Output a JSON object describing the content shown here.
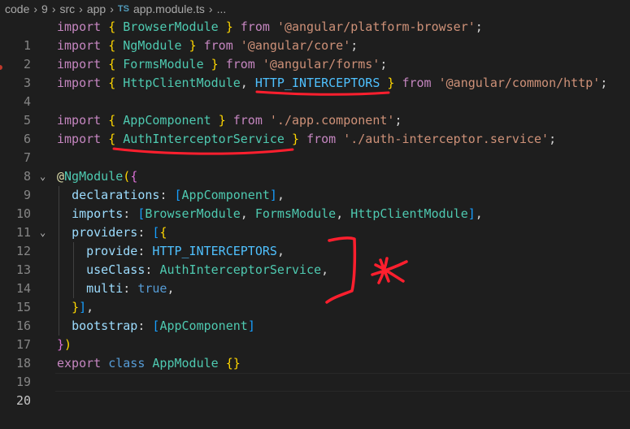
{
  "breadcrumb": {
    "items": [
      "code",
      "9",
      "src",
      "app"
    ],
    "file_badge": "TS",
    "file_name": "app.module.ts",
    "trailing": "..."
  },
  "line_numbers": [
    "1",
    "2",
    "3",
    "4",
    "5",
    "6",
    "7",
    "8",
    "9",
    "10",
    "11",
    "12",
    "13",
    "14",
    "15",
    "16",
    "17",
    "18",
    "19",
    "20"
  ],
  "tokens": {
    "import": "import",
    "from": "from",
    "open_brace": "{",
    "close_brace": "}",
    "semicolon": ";",
    "comma": ",",
    "BrowserModule": "BrowserModule",
    "NgModule": "NgModule",
    "FormsModule": "FormsModule",
    "HttpClientModule": "HttpClientModule",
    "HTTP_INTERCEPTORS": "HTTP_INTERCEPTORS",
    "AppComponent": "AppComponent",
    "AuthInterceptorService": "AuthInterceptorService",
    "str_platform_browser": "'@angular/platform-browser'",
    "str_core": "'@angular/core'",
    "str_forms": "'@angular/forms'",
    "str_common_http": "'@angular/common/http'",
    "str_app_component": "'./app.component'",
    "str_auth_interceptor": "'./auth-interceptor.service'",
    "at": "@",
    "open_paren": "(",
    "close_paren": ")",
    "declarations": "declarations",
    "imports": "imports",
    "providers": "providers",
    "provide": "provide",
    "useClass": "useClass",
    "multi": "multi",
    "true": "true",
    "bootstrap": "bootstrap",
    "open_bracket": "[",
    "close_bracket": "]",
    "colon": ":",
    "export": "export",
    "class": "class",
    "AppModule": "AppModule",
    "empty_braces": "{}"
  },
  "colors": {
    "background": "#1e1e1e",
    "keyword": "#c586c0",
    "storage": "#569cd6",
    "string": "#ce9178",
    "class": "#4ec9b0",
    "constant": "#4fc1ff",
    "property": "#9cdcfe",
    "decorator": "#dcdcaa",
    "annotation": "#ff1f2e"
  }
}
